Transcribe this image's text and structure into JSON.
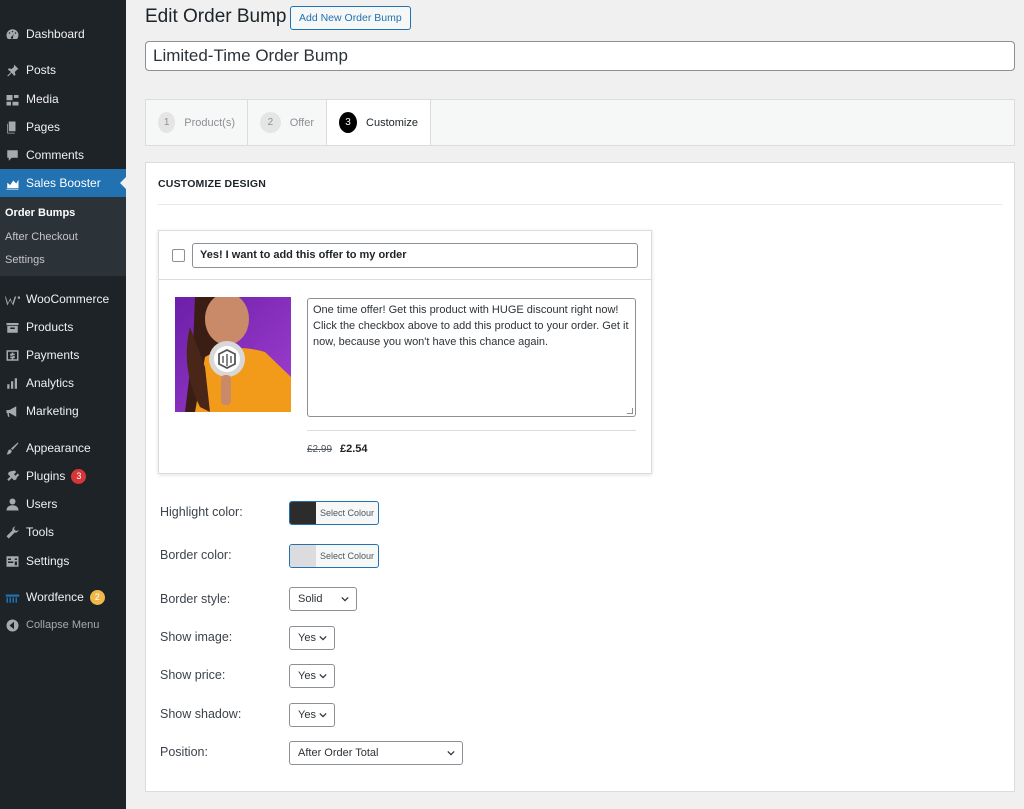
{
  "sidebar": {
    "items": [
      {
        "label": "Dashboard",
        "icon": "dashboard-icon"
      },
      {
        "label": "Posts",
        "icon": "pin-icon"
      },
      {
        "label": "Media",
        "icon": "media-icon"
      },
      {
        "label": "Pages",
        "icon": "pages-icon"
      },
      {
        "label": "Comments",
        "icon": "comment-icon"
      },
      {
        "label": "Sales Booster",
        "icon": "chart-icon"
      },
      {
        "label": "WooCommerce",
        "icon": "woo-icon"
      },
      {
        "label": "Products",
        "icon": "products-icon"
      },
      {
        "label": "Payments",
        "icon": "payments-icon"
      },
      {
        "label": "Analytics",
        "icon": "analytics-icon"
      },
      {
        "label": "Marketing",
        "icon": "megaphone-icon"
      },
      {
        "label": "Appearance",
        "icon": "brush-icon"
      },
      {
        "label": "Plugins",
        "icon": "plugin-icon",
        "badge": "3"
      },
      {
        "label": "Users",
        "icon": "users-icon"
      },
      {
        "label": "Tools",
        "icon": "wrench-icon"
      },
      {
        "label": "Settings",
        "icon": "settings-icon"
      },
      {
        "label": "Wordfence",
        "icon": "wordfence-icon",
        "badge": "2"
      },
      {
        "label": "Collapse Menu",
        "icon": "collapse-icon"
      }
    ],
    "submenu": [
      "Order Bumps",
      "After Checkout",
      "Settings"
    ]
  },
  "header": {
    "title": "Edit Order Bump",
    "add_new_label": "Add New Order Bump",
    "post_title": "Limited-Time Order Bump"
  },
  "steps": [
    {
      "num": "1",
      "label": "Product(s)"
    },
    {
      "num": "2",
      "label": "Offer"
    },
    {
      "num": "3",
      "label": "Customize"
    }
  ],
  "panel": {
    "title": "CUSTOMIZE DESIGN",
    "bump": {
      "headline": "Yes! I want to add this offer to my order",
      "description": "One time offer! Get this product with HUGE discount right now! Click the checkbox above to add this product to your order. Get it now, because you won't have this chance again.",
      "price_old": "£2.99",
      "price_new": "£2.54"
    },
    "fields": {
      "highlight_label": "Highlight color:",
      "highlight_color": "#2c2c2c",
      "border_label": "Border color:",
      "border_color": "#dcdcde",
      "select_colour": "Select Colour",
      "border_style_label": "Border style:",
      "border_style_value": "Solid",
      "show_image_label": "Show image:",
      "show_image_value": "Yes",
      "show_price_label": "Show price:",
      "show_price_value": "Yes",
      "show_shadow_label": "Show shadow:",
      "show_shadow_value": "Yes",
      "position_label": "Position:",
      "position_value": "After Order Total"
    }
  },
  "colors": {
    "accent": "#2271b1",
    "sidebar_bg": "#1d2327"
  }
}
